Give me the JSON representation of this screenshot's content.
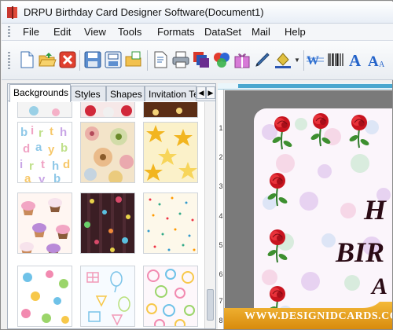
{
  "window": {
    "title": "DRPU Birthday Card Designer Software(Document1)"
  },
  "menu": [
    "File",
    "Edit",
    "View",
    "Tools",
    "Formats",
    "DataSet",
    "Mail",
    "Help"
  ],
  "toolbar": [
    "new-document-icon",
    "open-folder-icon",
    "close-icon",
    "save-icon",
    "save-as-icon",
    "open-template-icon",
    "print-preview-icon",
    "print-icon",
    "layers-icon",
    "color-palette-icon",
    "gift-icon",
    "pen-icon",
    "fill-color-icon",
    "wordart-icon",
    "barcode-icon",
    "text-icon",
    "font-size-icon"
  ],
  "left_panel": {
    "tabs": [
      "Backgrounds",
      "Styles",
      "Shapes",
      "Invitation Te"
    ],
    "thumbnails": [
      "bg-alphabet-letters",
      "bg-paisley-floral",
      "bg-yellow-stars",
      "bg-cupcakes",
      "bg-dark-confetti-dots",
      "bg-sprinkles",
      "bg-kids-toys",
      "bg-birthday-doodles",
      "bg-colorful-circles"
    ]
  },
  "ruler": {
    "numbers": [
      "1",
      "2",
      "3",
      "4",
      "5",
      "6",
      "7",
      "8"
    ]
  },
  "card": {
    "line1": "H",
    "line2": "BIR",
    "line3": "A"
  },
  "banner": {
    "text": "WWW.DESIGNIDCARDS.COM"
  },
  "colors": {
    "accent_blue": "#4aa7cf",
    "banner_gold": "#e9a31b",
    "card_text": "#2b0b15",
    "rose_red": "#d81c2a"
  }
}
